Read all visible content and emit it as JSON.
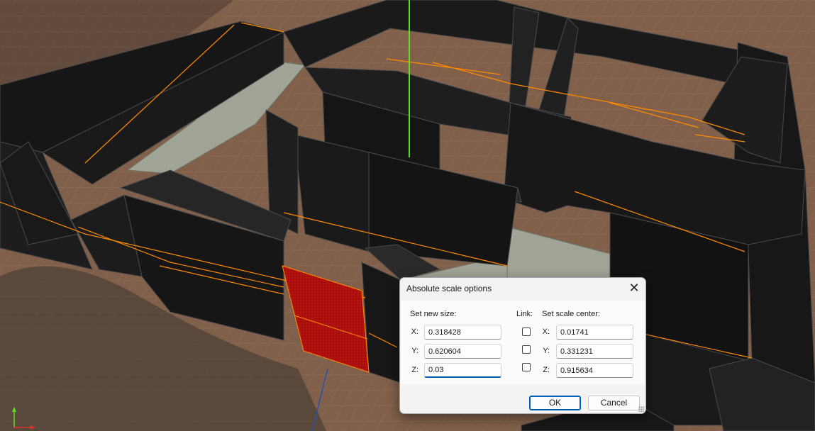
{
  "dialog": {
    "title": "Absolute scale options",
    "size_label": "Set new size:",
    "link_label": "Link:",
    "center_label": "Set scale center:",
    "size": [
      {
        "axis": "X:",
        "value": "0.318428"
      },
      {
        "axis": "Y:",
        "value": "0.620604"
      },
      {
        "axis": "Z:",
        "value": "0.03"
      }
    ],
    "link": [
      false,
      false,
      false
    ],
    "center": [
      {
        "axis": "X:",
        "value": "0.01741"
      },
      {
        "axis": "Y:",
        "value": "0.331231"
      },
      {
        "axis": "Z:",
        "value": "0.915634"
      }
    ],
    "ok_label": "OK",
    "cancel_label": "Cancel"
  },
  "icons": [
    "close-icon",
    "resize-grip-icon",
    "axis-gizmo-icon"
  ],
  "colors": {
    "selection_edge": "#ff8c00",
    "selected_face": "#b40f0f",
    "y_axis": "#5de021",
    "wall": "#1c1c1c",
    "floor": "#9fa496",
    "ground": "#7d5a43"
  }
}
